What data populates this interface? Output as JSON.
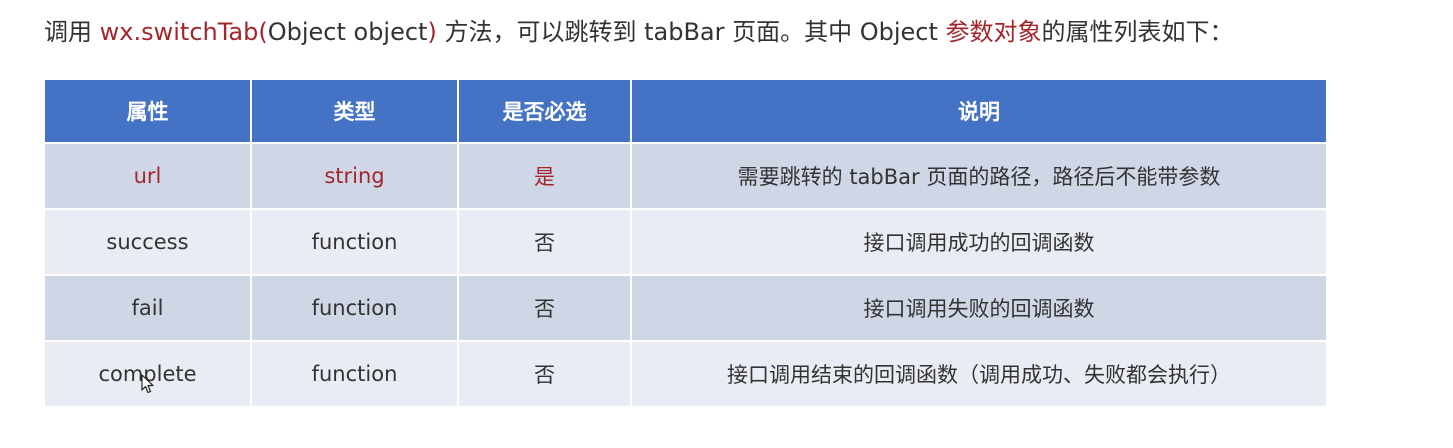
{
  "intro": {
    "p1": "调用 ",
    "p2": "wx.switchTab(",
    "p3": "Object object",
    "p4": ")",
    "p5": " 方法，可以跳转到 tabBar 页面。其中 Object ",
    "p6": "参数对象",
    "p7": "的属性列表如下："
  },
  "table": {
    "headers": [
      "属性",
      "类型",
      "是否必选",
      "说明"
    ],
    "rows": [
      {
        "name": "url",
        "type": "string",
        "required": "是",
        "desc": "需要跳转的 tabBar 页面的路径，路径后不能带参数"
      },
      {
        "name": "success",
        "type": "function",
        "required": "否",
        "desc": "接口调用成功的回调函数"
      },
      {
        "name": "fail",
        "type": "function",
        "required": "否",
        "desc": "接口调用失败的回调函数"
      },
      {
        "name": "complete",
        "type": "function",
        "required": "否",
        "desc": "接口调用结束的回调函数（调用成功、失败都会执行）"
      }
    ]
  },
  "colors": {
    "header_bg": "#4472c4",
    "highlight_red": "#a3262c",
    "row_dark": "#cfd6e6",
    "row_light": "#e9ecf4"
  },
  "icons": {
    "cursor": "mouse-pointer-icon"
  }
}
